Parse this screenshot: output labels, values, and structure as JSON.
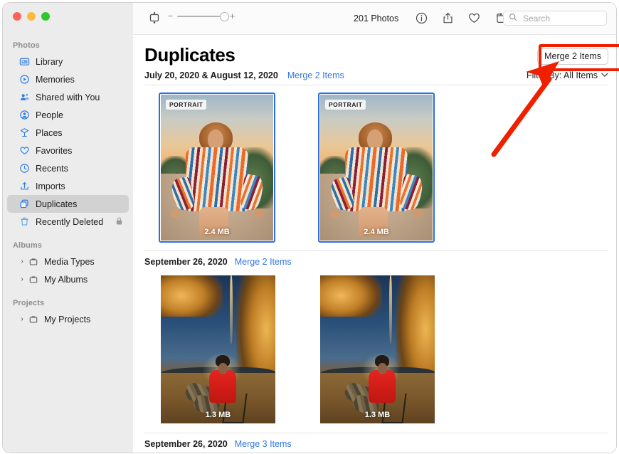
{
  "window": {
    "traffic_lights": [
      {
        "name": "close",
        "color": "#f9655b"
      },
      {
        "name": "minimize",
        "color": "#fcbb3f"
      },
      {
        "name": "zoom",
        "color": "#2fc72f"
      }
    ]
  },
  "sidebar": {
    "sections": [
      {
        "title": "Photos",
        "items": [
          {
            "label": "Library",
            "icon": "library-icon",
            "selected": false
          },
          {
            "label": "Memories",
            "icon": "memories-icon",
            "selected": false
          },
          {
            "label": "Shared with You",
            "icon": "shared-with-you-icon",
            "selected": false
          },
          {
            "label": "People",
            "icon": "people-icon",
            "selected": false
          },
          {
            "label": "Places",
            "icon": "places-icon",
            "selected": false
          },
          {
            "label": "Favorites",
            "icon": "heart-icon",
            "selected": false
          },
          {
            "label": "Recents",
            "icon": "clock-icon",
            "selected": false
          },
          {
            "label": "Imports",
            "icon": "import-icon",
            "selected": false
          },
          {
            "label": "Duplicates",
            "icon": "duplicates-icon",
            "selected": true
          },
          {
            "label": "Recently Deleted",
            "icon": "trash-icon",
            "selected": false,
            "lock": "lock-icon"
          }
        ]
      },
      {
        "title": "Albums",
        "items": [
          {
            "label": "Media Types",
            "icon": "folder-icon",
            "disclosure": "›"
          },
          {
            "label": "My Albums",
            "icon": "folder-icon",
            "disclosure": "›"
          }
        ]
      },
      {
        "title": "Projects",
        "items": [
          {
            "label": "My Projects",
            "icon": "folder-icon",
            "disclosure": "›"
          }
        ]
      }
    ]
  },
  "toolbar": {
    "view_mode_icon": "view-mode-icon",
    "zoom_out_label": "−",
    "zoom_in_label": "+",
    "zoom_value": 100,
    "photo_count": "201 Photos",
    "icons": [
      {
        "name": "info-icon"
      },
      {
        "name": "share-icon"
      },
      {
        "name": "favorite-heart-icon"
      },
      {
        "name": "rotate-icon"
      }
    ],
    "search": {
      "placeholder": "Search",
      "value": "",
      "icon": "search-icon"
    }
  },
  "main": {
    "page_title": "Duplicates",
    "merge_all_button": "Merge 2 Items",
    "subhead_date": "July 20, 2020 & August 12, 2020",
    "subhead_merge_link": "Merge 2 Items",
    "filter_label": "Filter By: All Items",
    "filter_chevron": "⌄",
    "groups": [
      {
        "date": "July 20, 2020 & August 12, 2020",
        "merge_label": "Merge 2 Items",
        "photos": [
          {
            "badge": "PORTRAIT",
            "size": "2.4 MB",
            "selected": true,
            "art": "sunset-cliff"
          },
          {
            "badge": "PORTRAIT",
            "size": "2.4 MB",
            "selected": true,
            "art": "sunset-cliff"
          }
        ]
      },
      {
        "date": "September 26, 2020",
        "merge_label": "Merge 2 Items",
        "photos": [
          {
            "badge": "",
            "size": "1.3 MB",
            "selected": false,
            "art": "night-lights"
          },
          {
            "badge": "",
            "size": "1.3 MB",
            "selected": false,
            "art": "night-lights"
          }
        ]
      },
      {
        "date": "September 26, 2020",
        "merge_label": "Merge 3 Items",
        "photos": []
      }
    ]
  },
  "annotation": {
    "box_color": "#f01f00",
    "arrow_color": "#f01f00",
    "highlights": "merge-all-button"
  }
}
